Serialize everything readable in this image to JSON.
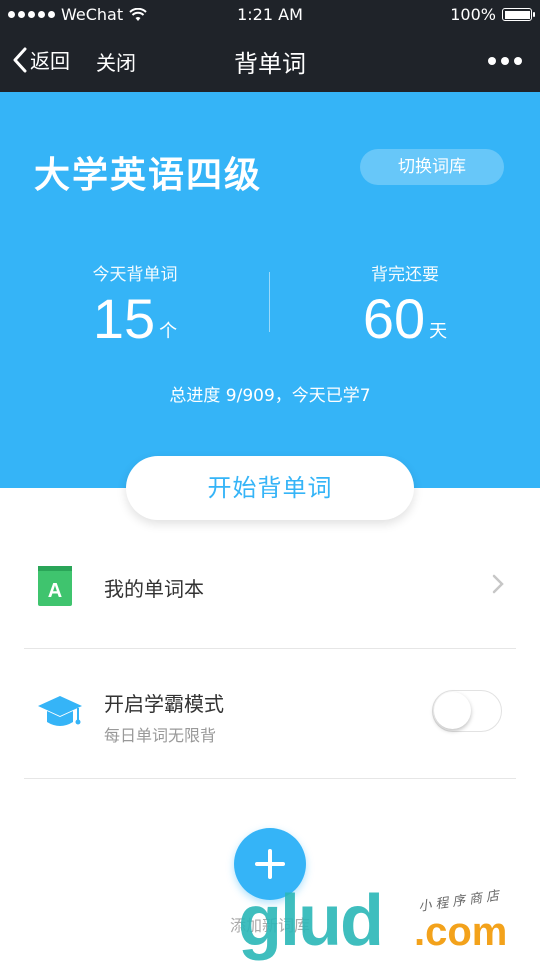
{
  "status_bar": {
    "carrier": "WeChat",
    "time": "1:21 AM",
    "battery": "100%"
  },
  "nav": {
    "back_label": "返回",
    "close_label": "关闭",
    "title": "背单词"
  },
  "hero": {
    "book_title": "大学英语四级",
    "switch_label": "切换词库",
    "today": {
      "label": "今天背单词",
      "value": "15",
      "unit": "个"
    },
    "remaining": {
      "label": "背完还要",
      "value": "60",
      "unit": "天"
    },
    "progress_text": "总进度 9/909，今天已学7",
    "background_color": "#35b4f7"
  },
  "start_button": {
    "label": "开始背单词"
  },
  "menu": {
    "wordbook": {
      "label": "我的单词本",
      "icon_letter": "A",
      "icon": "book-icon"
    },
    "master_mode": {
      "label": "开启学霸模式",
      "sub": "每日单词无限背",
      "icon": "graduation-cap-icon",
      "enabled": false
    }
  },
  "add_book": {
    "label": "添加新词库"
  },
  "watermark": {
    "main": "glud",
    "suffix": ".com",
    "cn": "小程序商店"
  }
}
